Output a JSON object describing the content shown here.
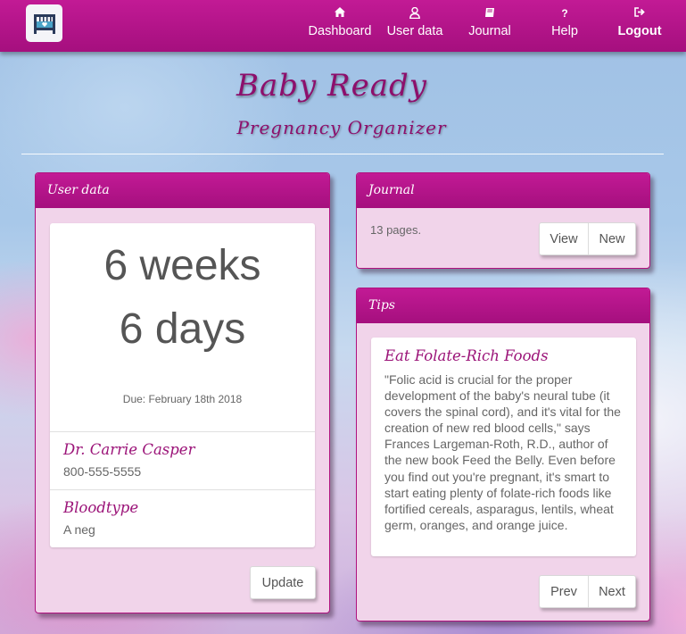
{
  "nav": {
    "logo_icon": "crib-icon",
    "items": [
      {
        "label": "Dashboard",
        "icon": "home-icon",
        "glyph": "⌂"
      },
      {
        "label": "User data",
        "icon": "user-icon",
        "glyph": "♙"
      },
      {
        "label": "Journal",
        "icon": "book-icon",
        "glyph": "▤"
      },
      {
        "label": "Help",
        "icon": "question-icon",
        "glyph": "?"
      },
      {
        "label": "Logout",
        "icon": "logout-icon",
        "glyph": "⇥"
      }
    ]
  },
  "header": {
    "title": "Baby Ready",
    "subtitle": "Pregnancy Organizer"
  },
  "user_panel": {
    "title": "User data",
    "weeks": "6 weeks",
    "days": "6 days",
    "due": "Due: February 18th 2018",
    "doctor_name": "Dr. Carrie Casper",
    "doctor_phone": "800-555-5555",
    "bloodtype_label": "Bloodtype",
    "bloodtype_value": "A neg",
    "update_label": "Update"
  },
  "journal_panel": {
    "title": "Journal",
    "pages_text": "13 pages.",
    "view_label": "View",
    "new_label": "New"
  },
  "tips_panel": {
    "title": "Tips",
    "tip_title": "Eat Folate-Rich Foods",
    "tip_body": "\"Folic acid is crucial for the proper development of the baby's neural tube (it covers the spinal cord), and it's vital for the creation of new red blood cells,\" says Frances Largeman-Roth, R.D., author of the new book Feed the Belly. Even before you find out you're pregnant, it's smart to start eating plenty of folate-rich foods like fortified cereals, asparagus, lentils, wheat germ, oranges, and orange juice.",
    "prev_label": "Prev",
    "next_label": "Next"
  },
  "colors": {
    "brand": "#b0127f",
    "panel_bg": "#f1d4ea",
    "heading_text": "#9b1378"
  }
}
